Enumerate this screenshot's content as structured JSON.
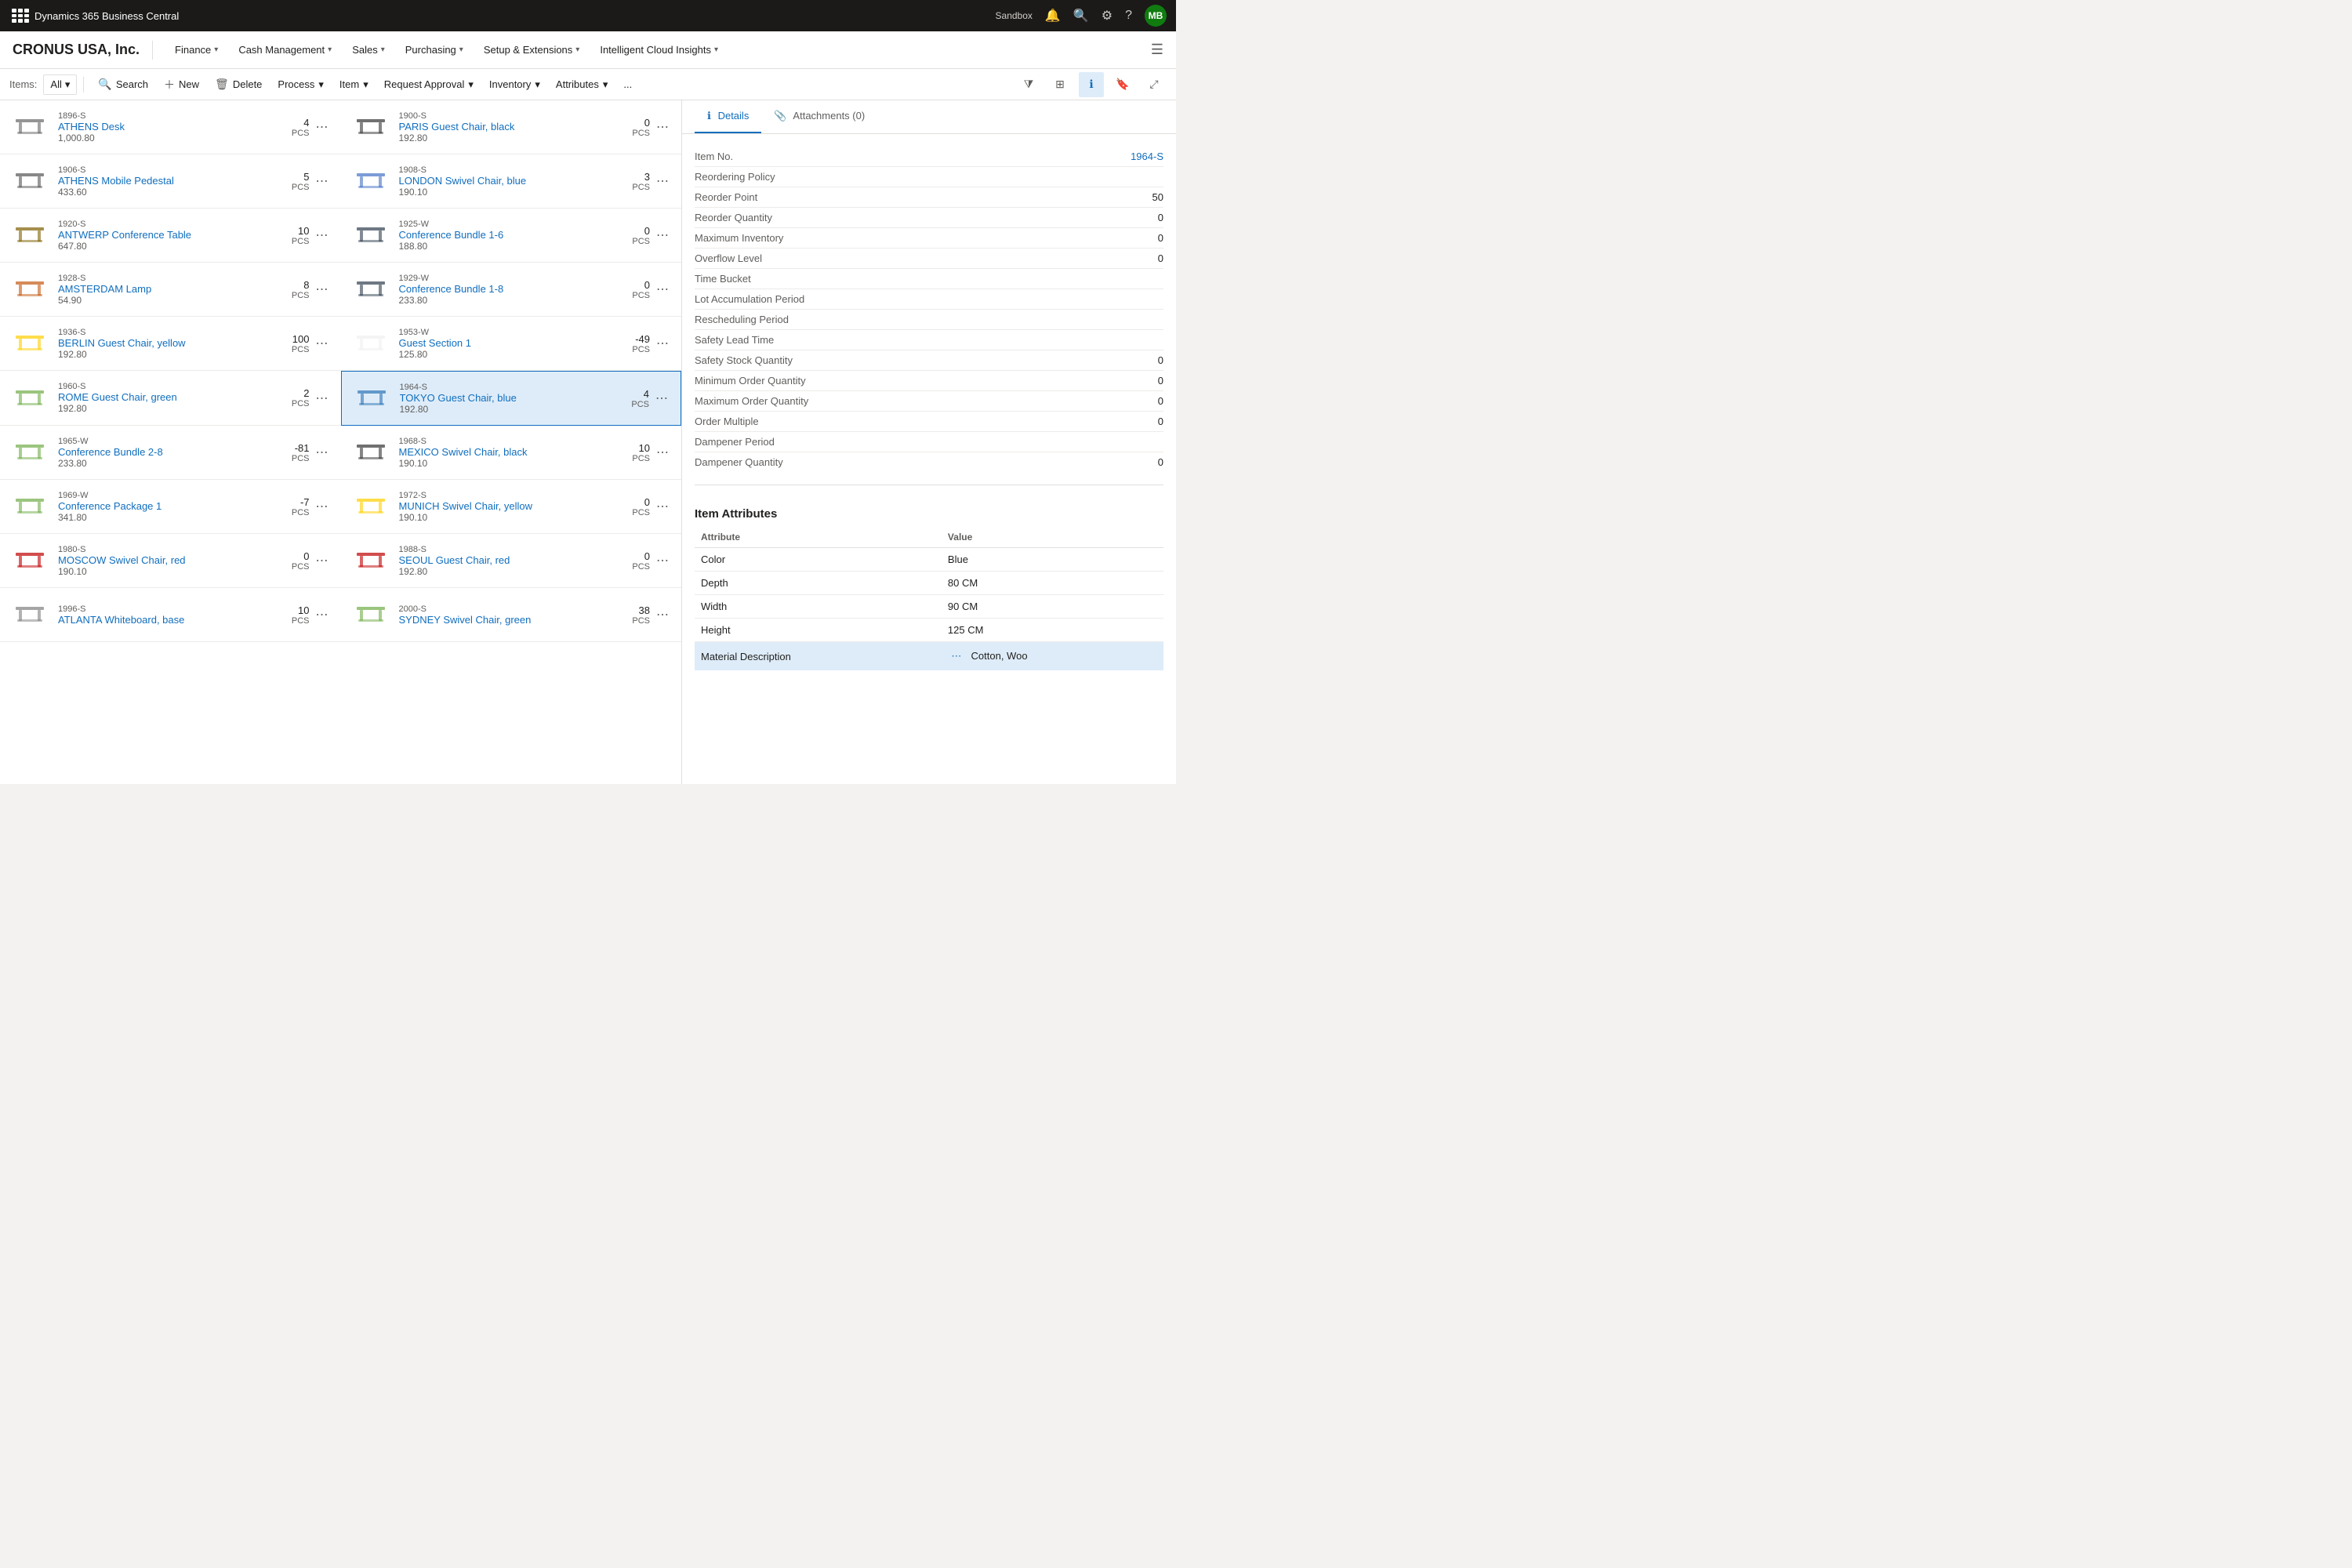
{
  "topbar": {
    "app_title": "Dynamics 365 Business Central",
    "sandbox_label": "Sandbox",
    "avatar_initials": "MB"
  },
  "menubar": {
    "company": "CRONUS USA, Inc.",
    "items": [
      {
        "label": "Finance",
        "has_chevron": true
      },
      {
        "label": "Cash Management",
        "has_chevron": true
      },
      {
        "label": "Sales",
        "has_chevron": true
      },
      {
        "label": "Purchasing",
        "has_chevron": true
      },
      {
        "label": "Setup & Extensions",
        "has_chevron": true
      },
      {
        "label": "Intelligent Cloud Insights",
        "has_chevron": true
      }
    ]
  },
  "toolbar": {
    "items_label": "Items:",
    "filter_label": "All",
    "search_label": "Search",
    "new_label": "New",
    "delete_label": "Delete",
    "process_label": "Process",
    "item_label": "Item",
    "request_approval_label": "Request Approval",
    "inventory_label": "Inventory",
    "attributes_label": "Attributes",
    "more_label": "..."
  },
  "list_items": [
    {
      "sku": "1896-S",
      "name": "ATHENS Desk",
      "price": "1,000.80",
      "qty": 4,
      "unit": "PCS"
    },
    {
      "sku": "1900-S",
      "name": "PARIS Guest Chair, black",
      "price": "192.80",
      "qty": 0,
      "unit": "PCS"
    },
    {
      "sku": "1906-S",
      "name": "ATHENS Mobile Pedestal",
      "price": "433.60",
      "qty": 5,
      "unit": "PCS"
    },
    {
      "sku": "1908-S",
      "name": "LONDON Swivel Chair, blue",
      "price": "190.10",
      "qty": 3,
      "unit": "PCS"
    },
    {
      "sku": "1920-S",
      "name": "ANTWERP Conference Table",
      "price": "647.80",
      "qty": 10,
      "unit": "PCS"
    },
    {
      "sku": "1925-W",
      "name": "Conference Bundle 1-6",
      "price": "188.80",
      "qty": 0,
      "unit": "PCS"
    },
    {
      "sku": "1928-S",
      "name": "AMSTERDAM Lamp",
      "price": "54.90",
      "qty": 8,
      "unit": "PCS"
    },
    {
      "sku": "1929-W",
      "name": "Conference Bundle 1-8",
      "price": "233.80",
      "qty": 0,
      "unit": "PCS"
    },
    {
      "sku": "1936-S",
      "name": "BERLIN Guest Chair, yellow",
      "price": "192.80",
      "qty": 100,
      "unit": "PCS"
    },
    {
      "sku": "1953-W",
      "name": "Guest Section 1",
      "price": "125.80",
      "qty": -49,
      "unit": "PCS"
    },
    {
      "sku": "1960-S",
      "name": "ROME Guest Chair, green",
      "price": "192.80",
      "qty": 2,
      "unit": "PCS"
    },
    {
      "sku": "1964-S",
      "name": "TOKYO Guest Chair, blue",
      "price": "192.80",
      "qty": 4,
      "unit": "PCS",
      "selected": true
    },
    {
      "sku": "1965-W",
      "name": "Conference Bundle 2-8",
      "price": "233.80",
      "qty": -81,
      "unit": "PCS"
    },
    {
      "sku": "1968-S",
      "name": "MEXICO Swivel Chair, black",
      "price": "190.10",
      "qty": 10,
      "unit": "PCS"
    },
    {
      "sku": "1969-W",
      "name": "Conference Package 1",
      "price": "341.80",
      "qty": -7,
      "unit": "PCS"
    },
    {
      "sku": "1972-S",
      "name": "MUNICH Swivel Chair, yellow",
      "price": "190.10",
      "qty": 0,
      "unit": "PCS"
    },
    {
      "sku": "1980-S",
      "name": "MOSCOW Swivel Chair, red",
      "price": "190.10",
      "qty": 0,
      "unit": "PCS"
    },
    {
      "sku": "1988-S",
      "name": "SEOUL Guest Chair, red",
      "price": "192.80",
      "qty": 0,
      "unit": "PCS"
    },
    {
      "sku": "1996-S",
      "name": "ATLANTA Whiteboard, base",
      "price": "",
      "qty": 10,
      "unit": "PCS"
    },
    {
      "sku": "2000-S",
      "name": "SYDNEY Swivel Chair, green",
      "price": "",
      "qty": 38,
      "unit": "PCS"
    }
  ],
  "detail": {
    "tabs": [
      {
        "label": "Details",
        "icon": "ℹ",
        "active": true
      },
      {
        "label": "Attachments (0)",
        "icon": "📎",
        "active": false
      }
    ],
    "fields": [
      {
        "label": "Item No.",
        "value": "1964-S",
        "is_link": true
      },
      {
        "label": "Reordering Policy",
        "value": ""
      },
      {
        "label": "Reorder Point",
        "value": "50"
      },
      {
        "label": "Reorder Quantity",
        "value": "0"
      },
      {
        "label": "Maximum Inventory",
        "value": "0"
      },
      {
        "label": "Overflow Level",
        "value": "0"
      },
      {
        "label": "Time Bucket",
        "value": ""
      },
      {
        "label": "Lot Accumulation Period",
        "value": ""
      },
      {
        "label": "Rescheduling Period",
        "value": ""
      },
      {
        "label": "Safety Lead Time",
        "value": ""
      },
      {
        "label": "Safety Stock Quantity",
        "value": "0"
      },
      {
        "label": "Minimum Order Quantity",
        "value": "0"
      },
      {
        "label": "Maximum Order Quantity",
        "value": "0"
      },
      {
        "label": "Order Multiple",
        "value": "0"
      },
      {
        "label": "Dampener Period",
        "value": ""
      },
      {
        "label": "Dampener Quantity",
        "value": "0"
      }
    ],
    "attributes_heading": "Item Attributes",
    "attributes_col_header": [
      "Attribute",
      "Value"
    ],
    "attributes": [
      {
        "attribute": "Color",
        "value": "Blue"
      },
      {
        "attribute": "Depth",
        "value": "80 CM"
      },
      {
        "attribute": "Width",
        "value": "90 CM"
      },
      {
        "attribute": "Height",
        "value": "125 CM"
      },
      {
        "attribute": "Material Description",
        "value": "Cotton, Woo"
      }
    ]
  }
}
